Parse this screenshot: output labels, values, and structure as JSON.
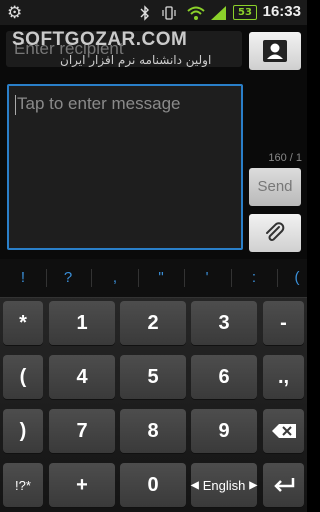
{
  "status_bar": {
    "time": "16:33",
    "battery_level": "53",
    "icons": [
      "gear-icon",
      "bluetooth-icon",
      "vibrate-icon",
      "wifi-icon",
      "signal-icon",
      "battery-icon"
    ]
  },
  "watermark": {
    "main": "SOFTGOZAR.COM",
    "sub": "اولین دانشنامه نرم افزار ایران"
  },
  "compose": {
    "recipient_placeholder": "Enter recipient",
    "message_placeholder": "Tap to enter message",
    "char_counter": "160 / 1",
    "send_label": "Send",
    "accent_color": "#2a7fc9"
  },
  "keyboard": {
    "suggestions": [
      "!",
      "?",
      ",",
      "\"",
      "'",
      ":",
      "("
    ],
    "rows": [
      [
        "*",
        "1",
        "2",
        "3",
        "-"
      ],
      [
        "(",
        "4",
        "5",
        "6",
        ".,"
      ],
      [
        ")",
        "7",
        "8",
        "9",
        "backspace"
      ],
      [
        "!?*",
        "+",
        "0",
        "English",
        "enter"
      ]
    ],
    "language_label": "English"
  }
}
